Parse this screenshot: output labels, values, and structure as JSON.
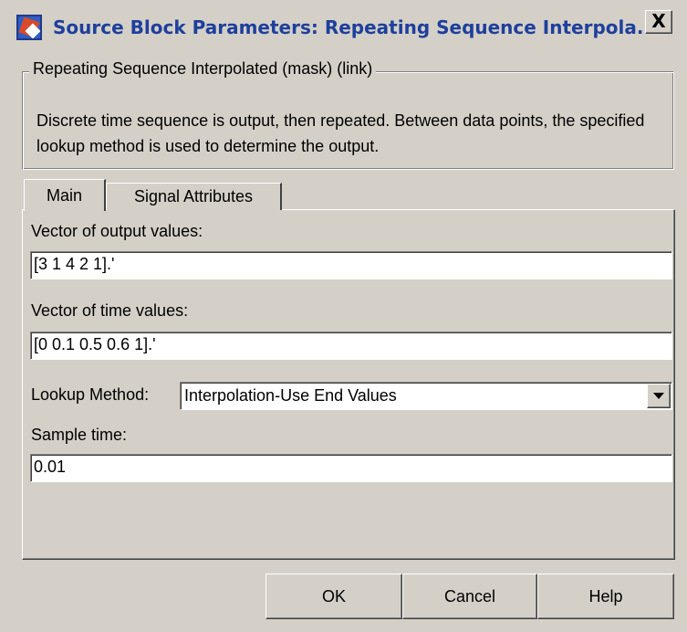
{
  "window": {
    "title": "Source Block Parameters: Repeating Sequence Interpola...",
    "close_label": "X",
    "app_icon": "simulink-block-icon"
  },
  "group": {
    "legend": "Repeating Sequence Interpolated (mask) (link)",
    "description": "Discrete time sequence is output, then repeated.  Between data points, the specified lookup method is used to determine the output."
  },
  "tabs": [
    {
      "label": "Main",
      "selected": true
    },
    {
      "label": "Signal Attributes",
      "selected": false
    }
  ],
  "form": {
    "output_values_label": "Vector of output values:",
    "output_values": "[3 1 4 2 1].'",
    "time_values_label": "Vector of time values:",
    "time_values": "[0 0.1 0.5 0.6 1].'",
    "lookup_method_label": "Lookup Method:",
    "lookup_method_value": "Interpolation-Use End Values",
    "sample_time_label": "Sample time:",
    "sample_time": "0.01"
  },
  "buttons": {
    "ok": "OK",
    "cancel": "Cancel",
    "help": "Help"
  },
  "colors": {
    "face": "#d4d0c8",
    "title_text": "#1e3f9c"
  }
}
